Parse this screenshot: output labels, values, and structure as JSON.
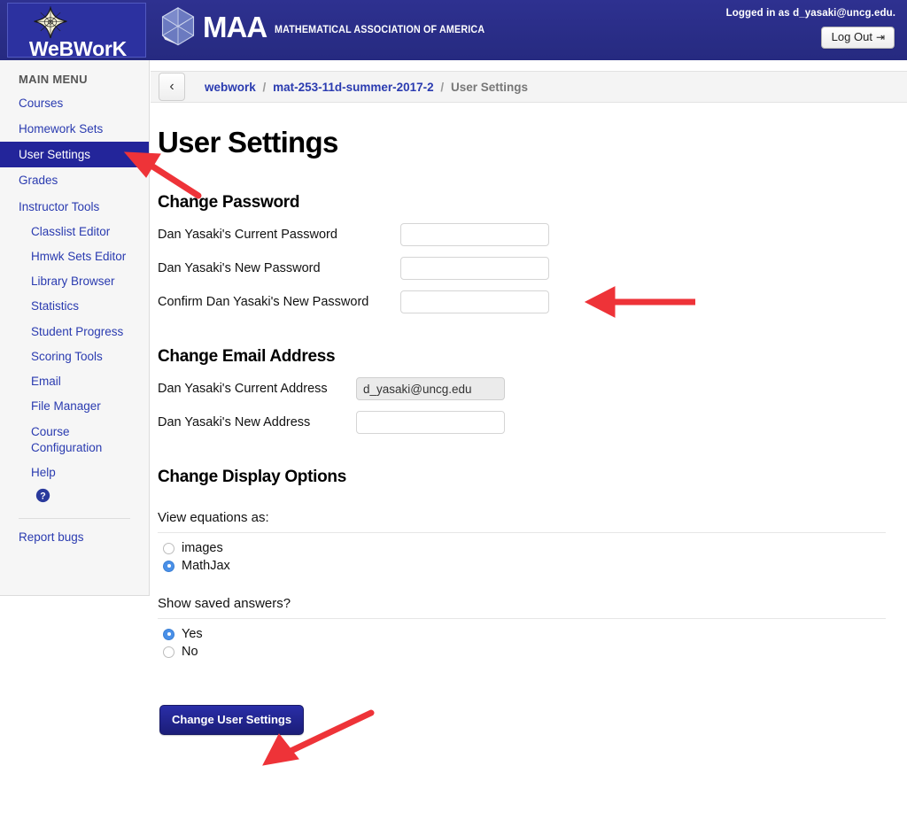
{
  "header": {
    "site_name": "WeBWorK",
    "org_abbrev": "MAA",
    "org_full_name": "MATHEMATICAL ASSOCIATION OF AMERICA",
    "logged_in_text": "Logged in as d_yasaki@uncg.edu.",
    "logout_label": "Log Out",
    "logout_icon": "sign-out-icon",
    "brand_color": "#2b2f89"
  },
  "sidebar": {
    "title": "MAIN MENU",
    "items": [
      {
        "label": "Courses",
        "level": "top",
        "active": false
      },
      {
        "label": "Homework Sets",
        "level": "top",
        "active": false
      },
      {
        "label": "User Settings",
        "level": "top",
        "active": true
      },
      {
        "label": "Grades",
        "level": "top",
        "active": false
      },
      {
        "label": "Instructor Tools",
        "level": "top",
        "active": false
      },
      {
        "label": "Classlist Editor",
        "level": "sub",
        "active": false
      },
      {
        "label": "Hmwk Sets Editor",
        "level": "sub",
        "active": false
      },
      {
        "label": "Library Browser",
        "level": "sub",
        "active": false
      },
      {
        "label": "Statistics",
        "level": "sub",
        "active": false
      },
      {
        "label": "Student Progress",
        "level": "sub",
        "active": false
      },
      {
        "label": "Scoring Tools",
        "level": "sub",
        "active": false
      },
      {
        "label": "Email",
        "level": "sub",
        "active": false
      },
      {
        "label": "File Manager",
        "level": "sub",
        "active": false
      },
      {
        "label": "Course Configuration",
        "level": "sub",
        "active": false
      },
      {
        "label": "Help",
        "level": "sub",
        "active": false
      }
    ],
    "help_icon": "question-circle-icon",
    "report_bugs_label": "Report bugs",
    "active_color": "#23259a",
    "link_color": "#2a3bb0"
  },
  "breadcrumb": {
    "back_icon": "chevron-left-icon",
    "items": [
      "webwork",
      "mat-253-11d-summer-2017-2",
      "User Settings"
    ],
    "separator": "/"
  },
  "main": {
    "page_title": "User Settings",
    "password_section": {
      "heading": "Change Password",
      "fields": [
        {
          "label": "Dan Yasaki's Current Password",
          "value": "",
          "readonly": false
        },
        {
          "label": "Dan Yasaki's New Password",
          "value": "",
          "readonly": false
        },
        {
          "label": "Confirm Dan Yasaki's New Password",
          "value": "",
          "readonly": false
        }
      ]
    },
    "email_section": {
      "heading": "Change Email Address",
      "fields": [
        {
          "label": "Dan Yasaki's Current Address",
          "value": "d_yasaki@uncg.edu",
          "readonly": true
        },
        {
          "label": "Dan Yasaki's New Address",
          "value": "",
          "readonly": false
        }
      ]
    },
    "display_section": {
      "heading": "Change Display Options",
      "groups": [
        {
          "question": "View equations as:",
          "options": [
            {
              "label": "images",
              "checked": false
            },
            {
              "label": "MathJax",
              "checked": true
            }
          ]
        },
        {
          "question": "Show saved answers?",
          "options": [
            {
              "label": "Yes",
              "checked": true
            },
            {
              "label": "No",
              "checked": false
            }
          ]
        }
      ]
    },
    "submit_label": "Change User Settings"
  },
  "annotations": {
    "color": "#ee3338",
    "arrows": [
      {
        "name": "arrow-to-user-settings",
        "points_to": "User Settings sidebar item"
      },
      {
        "name": "arrow-to-new-password-field",
        "points_to": "Dan Yasaki's New Password input"
      },
      {
        "name": "arrow-to-change-user-settings-button",
        "points_to": "Change User Settings button"
      }
    ]
  }
}
